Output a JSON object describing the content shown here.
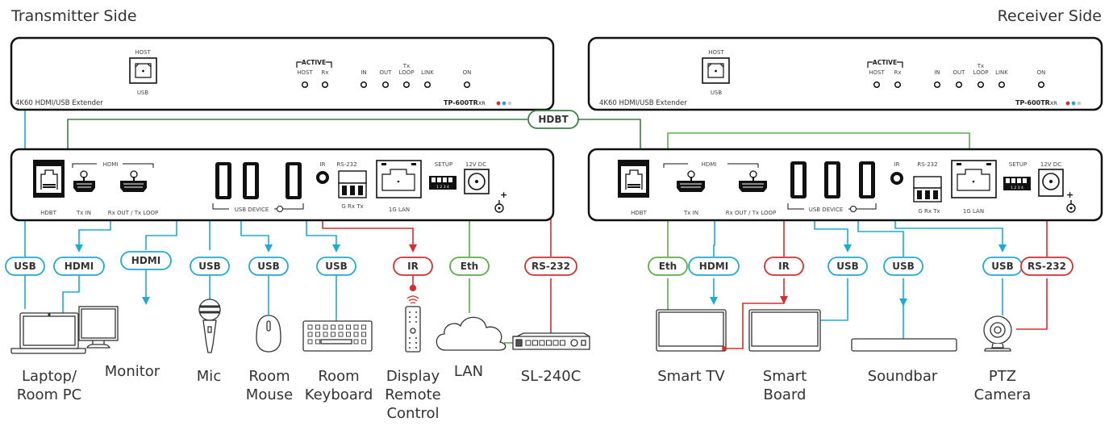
{
  "titles": {
    "transmitter": "Transmitter Side",
    "receiver": "Receiver Side"
  },
  "colors": {
    "usb_hdmi": "#1eaad8",
    "ir_rs232": "#d32f2f",
    "eth": "#5cae48",
    "hdbt": "#3d7d4a",
    "panel_border": "#111111"
  },
  "front_panel": {
    "host_label": "HOST",
    "usb_label": "USB",
    "product_desc": "4K60 HDMI/USB Extender",
    "active_label": "ACTIVE",
    "led_labels": [
      "HOST",
      "Rx",
      "IN",
      "OUT",
      "LOOP",
      "LINK",
      "ON"
    ],
    "tx_label": "Tx",
    "model": "TP-600TR",
    "model_suffix": "XR"
  },
  "rear_panel": {
    "hdbt": "HDBT",
    "hdmi": "HDMI",
    "tx_in": "Tx IN",
    "rx_out": "Rx OUT / Tx LOOP",
    "usb_device": "USB DEVICE",
    "ir": "IR",
    "rs232": "RS-232",
    "g_rx_tx": "G  Rx  Tx",
    "lan": "1G LAN",
    "setup": "SETUP",
    "setup_digits": "1 2 3 4",
    "dc": "12V DC"
  },
  "hdbt_link": "HDBT",
  "transmitter_pills": [
    {
      "label": "USB",
      "type": "usb"
    },
    {
      "label": "HDMI",
      "type": "usb"
    },
    {
      "label": "HDMI",
      "type": "usb"
    },
    {
      "label": "USB",
      "type": "usb"
    },
    {
      "label": "USB",
      "type": "usb"
    },
    {
      "label": "USB",
      "type": "usb"
    },
    {
      "label": "IR",
      "type": "ir"
    },
    {
      "label": "Eth",
      "type": "eth"
    },
    {
      "label": "RS-232",
      "type": "ir"
    }
  ],
  "receiver_pills": [
    {
      "label": "Eth",
      "type": "eth"
    },
    {
      "label": "HDMI",
      "type": "usb"
    },
    {
      "label": "IR",
      "type": "ir"
    },
    {
      "label": "USB",
      "type": "usb"
    },
    {
      "label": "USB",
      "type": "usb"
    },
    {
      "label": "USB",
      "type": "usb"
    },
    {
      "label": "RS-232",
      "type": "ir"
    }
  ],
  "transmitter_devices": [
    {
      "line1": "Laptop/",
      "line2": "Room PC",
      "line3": ""
    },
    {
      "line1": "Monitor",
      "line2": "",
      "line3": ""
    },
    {
      "line1": "Mic",
      "line2": "",
      "line3": ""
    },
    {
      "line1": "Room",
      "line2": "Mouse",
      "line3": ""
    },
    {
      "line1": "Room",
      "line2": "Keyboard",
      "line3": ""
    },
    {
      "line1": "Display",
      "line2": "Remote",
      "line3": "Control"
    },
    {
      "line1": "LAN",
      "line2": "",
      "line3": ""
    },
    {
      "line1": "SL-240C",
      "line2": "",
      "line3": ""
    }
  ],
  "receiver_devices": [
    {
      "line1": "Smart TV",
      "line2": ""
    },
    {
      "line1": "Smart",
      "line2": "Board"
    },
    {
      "line1": "Soundbar",
      "line2": ""
    },
    {
      "line1": "PTZ",
      "line2": "Camera"
    }
  ]
}
